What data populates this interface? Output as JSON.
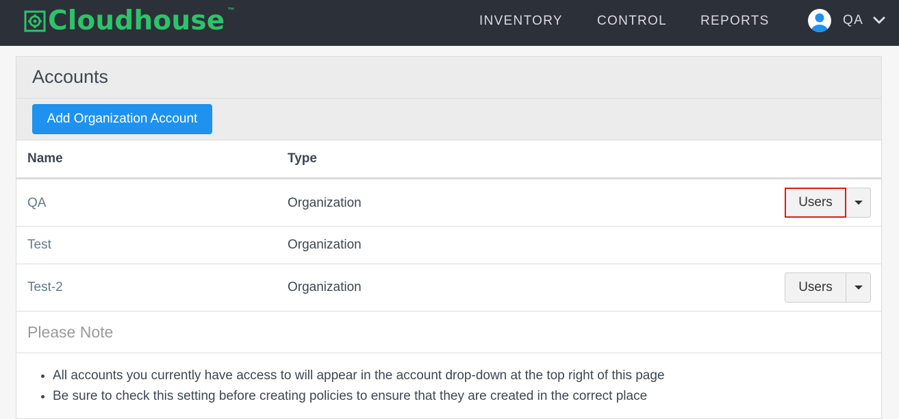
{
  "navbar": {
    "brand": "Cloudhouse",
    "brand_tm": "™",
    "links": {
      "inventory": "INVENTORY",
      "control": "CONTROL",
      "reports": "REPORTS"
    },
    "user": "QA"
  },
  "panel": {
    "title": "Accounts",
    "add_button": "Add Organization Account",
    "columns": {
      "name": "Name",
      "type": "Type"
    },
    "rows": [
      {
        "name": "QA",
        "type": "Organization",
        "action": "Users"
      },
      {
        "name": "Test",
        "type": "Organization"
      },
      {
        "name": "Test-2",
        "type": "Organization",
        "action": "Users"
      }
    ],
    "note_title": "Please Note",
    "notes": [
      "All accounts you currently have access to will appear in the account drop-down at the top right of this page",
      "Be sure to check this setting before creating policies to ensure that they are created in the correct place"
    ]
  },
  "colors": {
    "nav_bg": "#2c3039",
    "brand_green": "#2dc36a",
    "primary_button": "#1e92ee",
    "highlight": "#e0161b"
  }
}
